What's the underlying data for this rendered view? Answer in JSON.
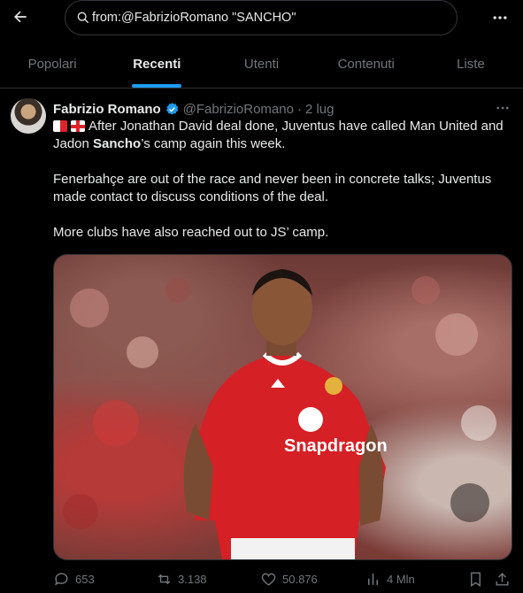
{
  "header": {
    "search": {
      "value": "from:@FabrizioRomano \"SANCHO\""
    },
    "icons": {
      "back": "arrow-left-icon",
      "search": "search-icon",
      "more": "more-horizontal-icon"
    }
  },
  "tabs": [
    {
      "label": "Popolari",
      "active": false
    },
    {
      "label": "Recenti",
      "active": true
    },
    {
      "label": "Utenti",
      "active": false
    },
    {
      "label": "Contenuti",
      "active": false
    },
    {
      "label": "Liste",
      "active": false
    }
  ],
  "tweet": {
    "author_name": "Fabrizio Romano",
    "handle": "@FabrizioRomano",
    "separator": "·",
    "date": "2 lug",
    "text": {
      "line1_prefix": "After Jonathan David deal done, Juventus have called Man United and Jadon ",
      "line1_bold": "Sancho",
      "line1_suffix": "’s camp again this week.",
      "para2": "Fenerbahçe are out of the race and never been in concrete talks; Juventus made contact to discuss conditions of the deal.",
      "para3": "More clubs have also reached out to JS’ camp."
    },
    "media": {
      "shirt_sponsor": "Snapdragon"
    },
    "stats": {
      "replies": "653",
      "reposts": "3.138",
      "likes": "50.876",
      "views": "4 Mln"
    }
  },
  "colors": {
    "accent": "#1d9bf0",
    "muted": "#71767b",
    "text": "#e7e9ea",
    "divider": "#2f3336",
    "background": "#000000"
  }
}
